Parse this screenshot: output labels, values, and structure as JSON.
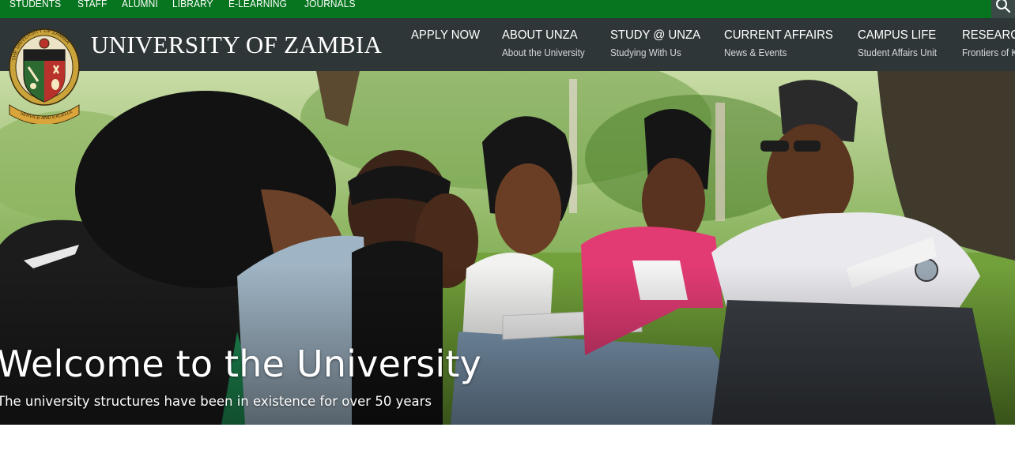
{
  "topbar": {
    "links": [
      "STUDENTS",
      "STAFF",
      "ALUMNI",
      "LIBRARY",
      "E-LEARNING",
      "JOURNALS"
    ],
    "search_icon": "search-icon"
  },
  "header": {
    "title": "UNIVERSITY OF ZAMBIA",
    "logo": {
      "icon": "university-crest-icon",
      "top_text": "THE UNIVERSITY OF ZAMBIA",
      "motto": "SERVICE AND EXCELLENCE"
    },
    "nav": [
      {
        "label": "APPLY NOW",
        "sub": ""
      },
      {
        "label": "ABOUT UNZA",
        "sub": "About the University"
      },
      {
        "label": "STUDY @ UNZA",
        "sub": "Studying With Us"
      },
      {
        "label": "CURRENT AFFAIRS",
        "sub": "News & Events"
      },
      {
        "label": "CAMPUS LIFE",
        "sub": "Student Affairs Unit"
      },
      {
        "label": "RESEARCH",
        "sub": "Frontiers of Knowledge"
      }
    ]
  },
  "hero": {
    "title": "Welcome to the University",
    "subtitle": "The university structures have been in existence for over 50 years"
  },
  "colors": {
    "topbar": "#07741f",
    "header": "#2f3638",
    "search_button": "#3b4a46"
  }
}
